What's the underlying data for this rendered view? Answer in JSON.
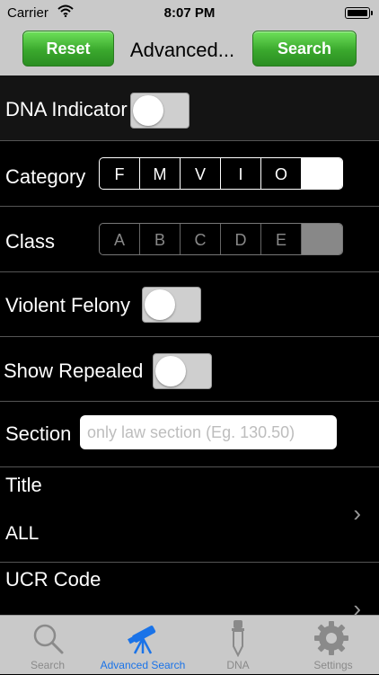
{
  "status_bar": {
    "carrier": "Carrier",
    "time": "8:07 PM"
  },
  "nav": {
    "reset_label": "Reset",
    "title": "Advanced...",
    "search_label": "Search"
  },
  "form": {
    "dna_indicator": {
      "label": "DNA Indicator",
      "on": false
    },
    "category": {
      "label": "Category",
      "options": [
        "F",
        "M",
        "V",
        "I",
        "O"
      ],
      "selected": ""
    },
    "class": {
      "label": "Class",
      "options": [
        "A",
        "B",
        "C",
        "D",
        "E"
      ],
      "selected": ""
    },
    "violent_felony": {
      "label": "Violent Felony",
      "on": false
    },
    "show_repealed": {
      "label": "Show Repealed",
      "on": false
    },
    "section": {
      "label": "Section",
      "placeholder": "only law section (Eg. 130.50)",
      "value": ""
    },
    "title": {
      "label": "Title",
      "value": "ALL"
    },
    "ucr_code": {
      "label": "UCR Code"
    }
  },
  "tabbar": {
    "tabs": [
      {
        "label": "Search",
        "icon": "search-icon"
      },
      {
        "label": "Advanced Search",
        "icon": "telescope-icon",
        "active": true
      },
      {
        "label": "DNA",
        "icon": "dropper-icon"
      },
      {
        "label": "Settings",
        "icon": "gear-icon"
      }
    ]
  },
  "colors": {
    "accent": "#1a73e8",
    "button_green": "#3aa82d",
    "bar_gray": "#c9c9c9"
  }
}
